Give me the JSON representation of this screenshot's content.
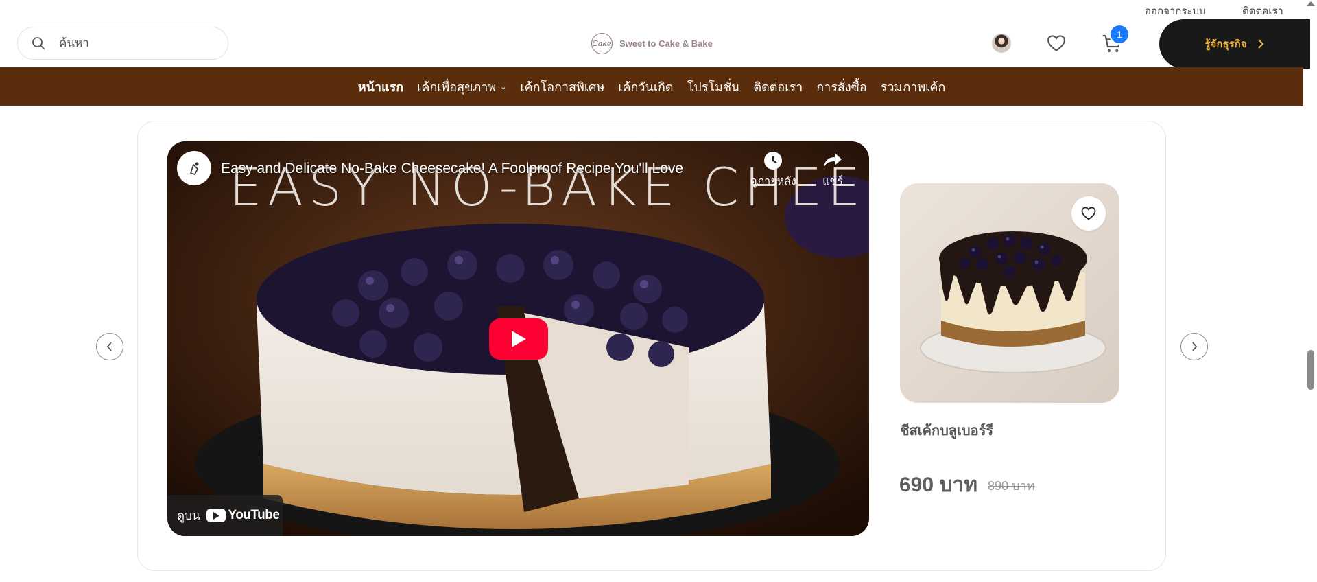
{
  "utility": {
    "logout": "ออกจากระบบ",
    "contact": "ติดต่อเรา"
  },
  "header": {
    "search_placeholder": "ค้นหา",
    "logo_text": "Sweet to Cake & Bake",
    "logo_mark": "Cake",
    "cart_count": "1",
    "business_button": "รู้จักธุรกิจ"
  },
  "nav": {
    "items": [
      {
        "label": "หน้าแรก"
      },
      {
        "label": "เค้กเพื่อสุขภาพ"
      },
      {
        "label": "เค้กโอกาสพิเศษ"
      },
      {
        "label": "เค้กวันเกิด"
      },
      {
        "label": "โปรโมชั่น"
      },
      {
        "label": "ติดต่อเรา"
      },
      {
        "label": "การสั่งซื้อ"
      },
      {
        "label": "รวมภาพเค้ก"
      }
    ]
  },
  "video": {
    "title": "Easy and Delicate No-Bake Cheesecake! A Foolproof Recipe You'll Love",
    "overlay_text": "EASY NO-BAKE CHEESECAKE",
    "watch_later": "ดูภายหลัง",
    "share": "แชร์",
    "watch_on": "ดูบน",
    "youtube": "YouTube"
  },
  "product": {
    "name": "ชีสเค้กบลูเบอร์รี",
    "price": "690 บาท",
    "old_price": "890 บาท"
  },
  "colors": {
    "nav_bg": "#5a2d0c",
    "accent_gold": "#f2b33d",
    "badge_blue": "#1b7bff",
    "play_red": "#ff0033"
  }
}
